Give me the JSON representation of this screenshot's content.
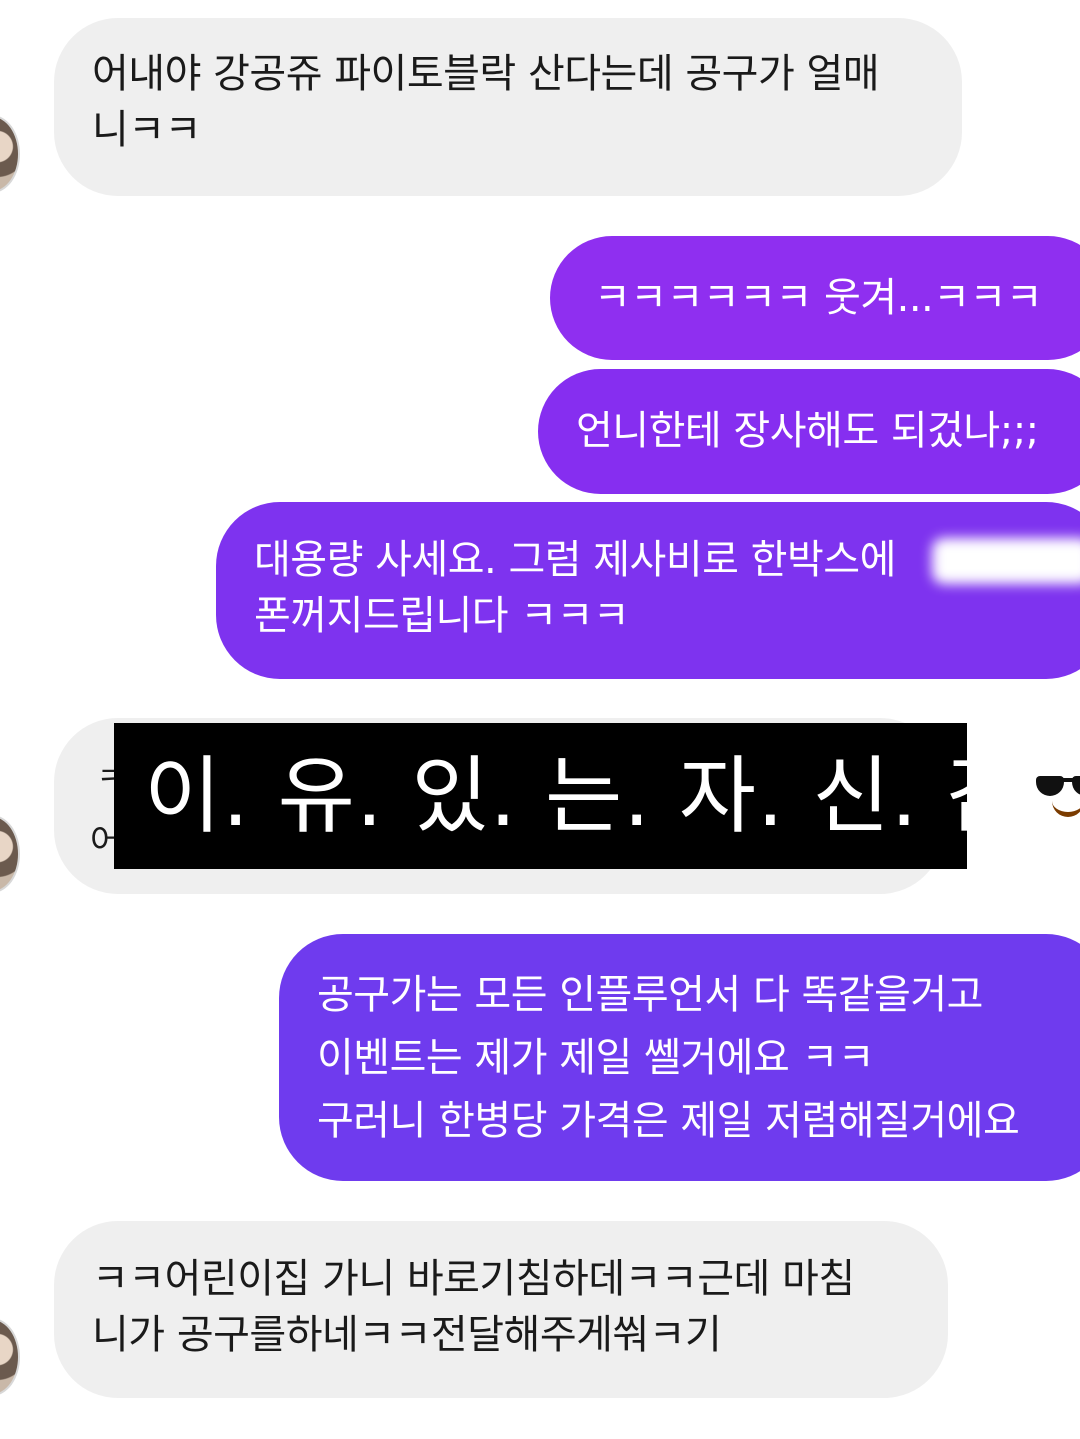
{
  "messages": [
    {
      "side": "in",
      "text": "어내야 강공쥬 파이토블락 산다는데 공구가 얼매\n니ㅋㅋ"
    },
    {
      "side": "out",
      "text": "ㅋㅋㅋㅋㅋㅋ 웃겨...ㅋㅋㅋ"
    },
    {
      "side": "out",
      "text": "언니한테 장사해도 되겄나;;;"
    },
    {
      "side": "out",
      "text": "대용량 사세요. 그럼 제사비로 한박스에\n폰꺼지드립니다 ㅋㅋㅋ"
    },
    {
      "side": "in",
      "text_peek_1": "ㅋ",
      "text_peek_2": "어"
    },
    {
      "side": "out",
      "text": "공구가는 모든 인플루언서 다 똑같을거고\n이벤트는 제가 제일 쎌거에요 ㅋㅋ\n구러니 한병당 가격은 제일 저렴해질거에요"
    },
    {
      "side": "in",
      "text": "ㅋㅋ어린이집 가니 바로기침하데ㅋㅋ근데 마침\n니가 공구를하네ㅋㅋ전달해주게쒀ㅋ기"
    }
  ],
  "overlay": {
    "text": "이. 유. 있. 는. 자. 신. 감",
    "emoji": "smiling-face-with-sunglasses"
  },
  "colors": {
    "incoming_bubble": "#efefef",
    "outgoing_bubble": "#8a2df0",
    "overlay_bg": "#000000"
  }
}
